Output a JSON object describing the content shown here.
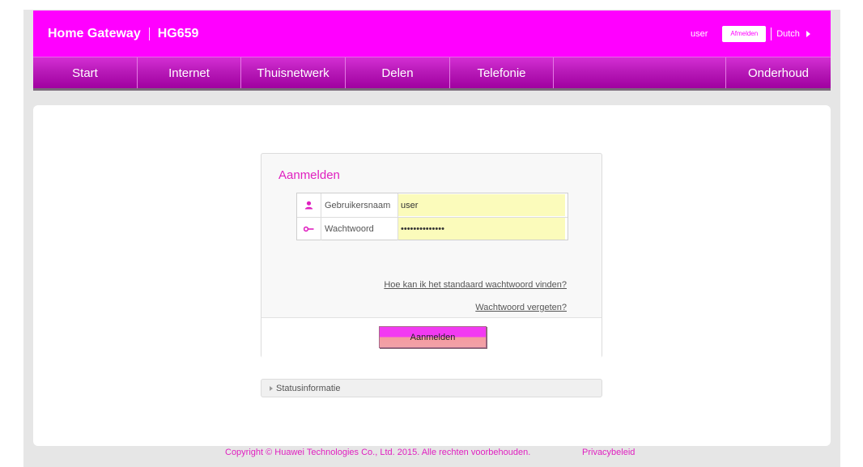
{
  "header": {
    "brand": "Home Gateway",
    "model": "HG659",
    "user": "user",
    "logout_label": "Afmelden",
    "language": "Dutch"
  },
  "nav": {
    "items": [
      "Start",
      "Internet",
      "Thuisnetwerk",
      "Delen",
      "Telefonie"
    ],
    "right_item": "Onderhoud"
  },
  "login": {
    "title": "Aanmelden",
    "username_label": "Gebruikersnaam",
    "username_value": "user",
    "password_label": "Wachtwoord",
    "password_value": "••••••••••••••",
    "default_password_link": "Hoe kan ik het standaard wachtwoord vinden?",
    "forgot_password_link": "Wachtwoord vergeten?",
    "submit_label": "Aanmelden"
  },
  "status": {
    "label": "Statusinformatie"
  },
  "footer": {
    "copyright": "Copyright © Huawei Technologies Co., Ltd. 2015. Alle rechten voorbehouden.",
    "privacy": "Privacybeleid"
  },
  "colors": {
    "brand": "#ff00ff",
    "input_bg": "#fbfbbb",
    "accent_text": "#e020c0"
  }
}
